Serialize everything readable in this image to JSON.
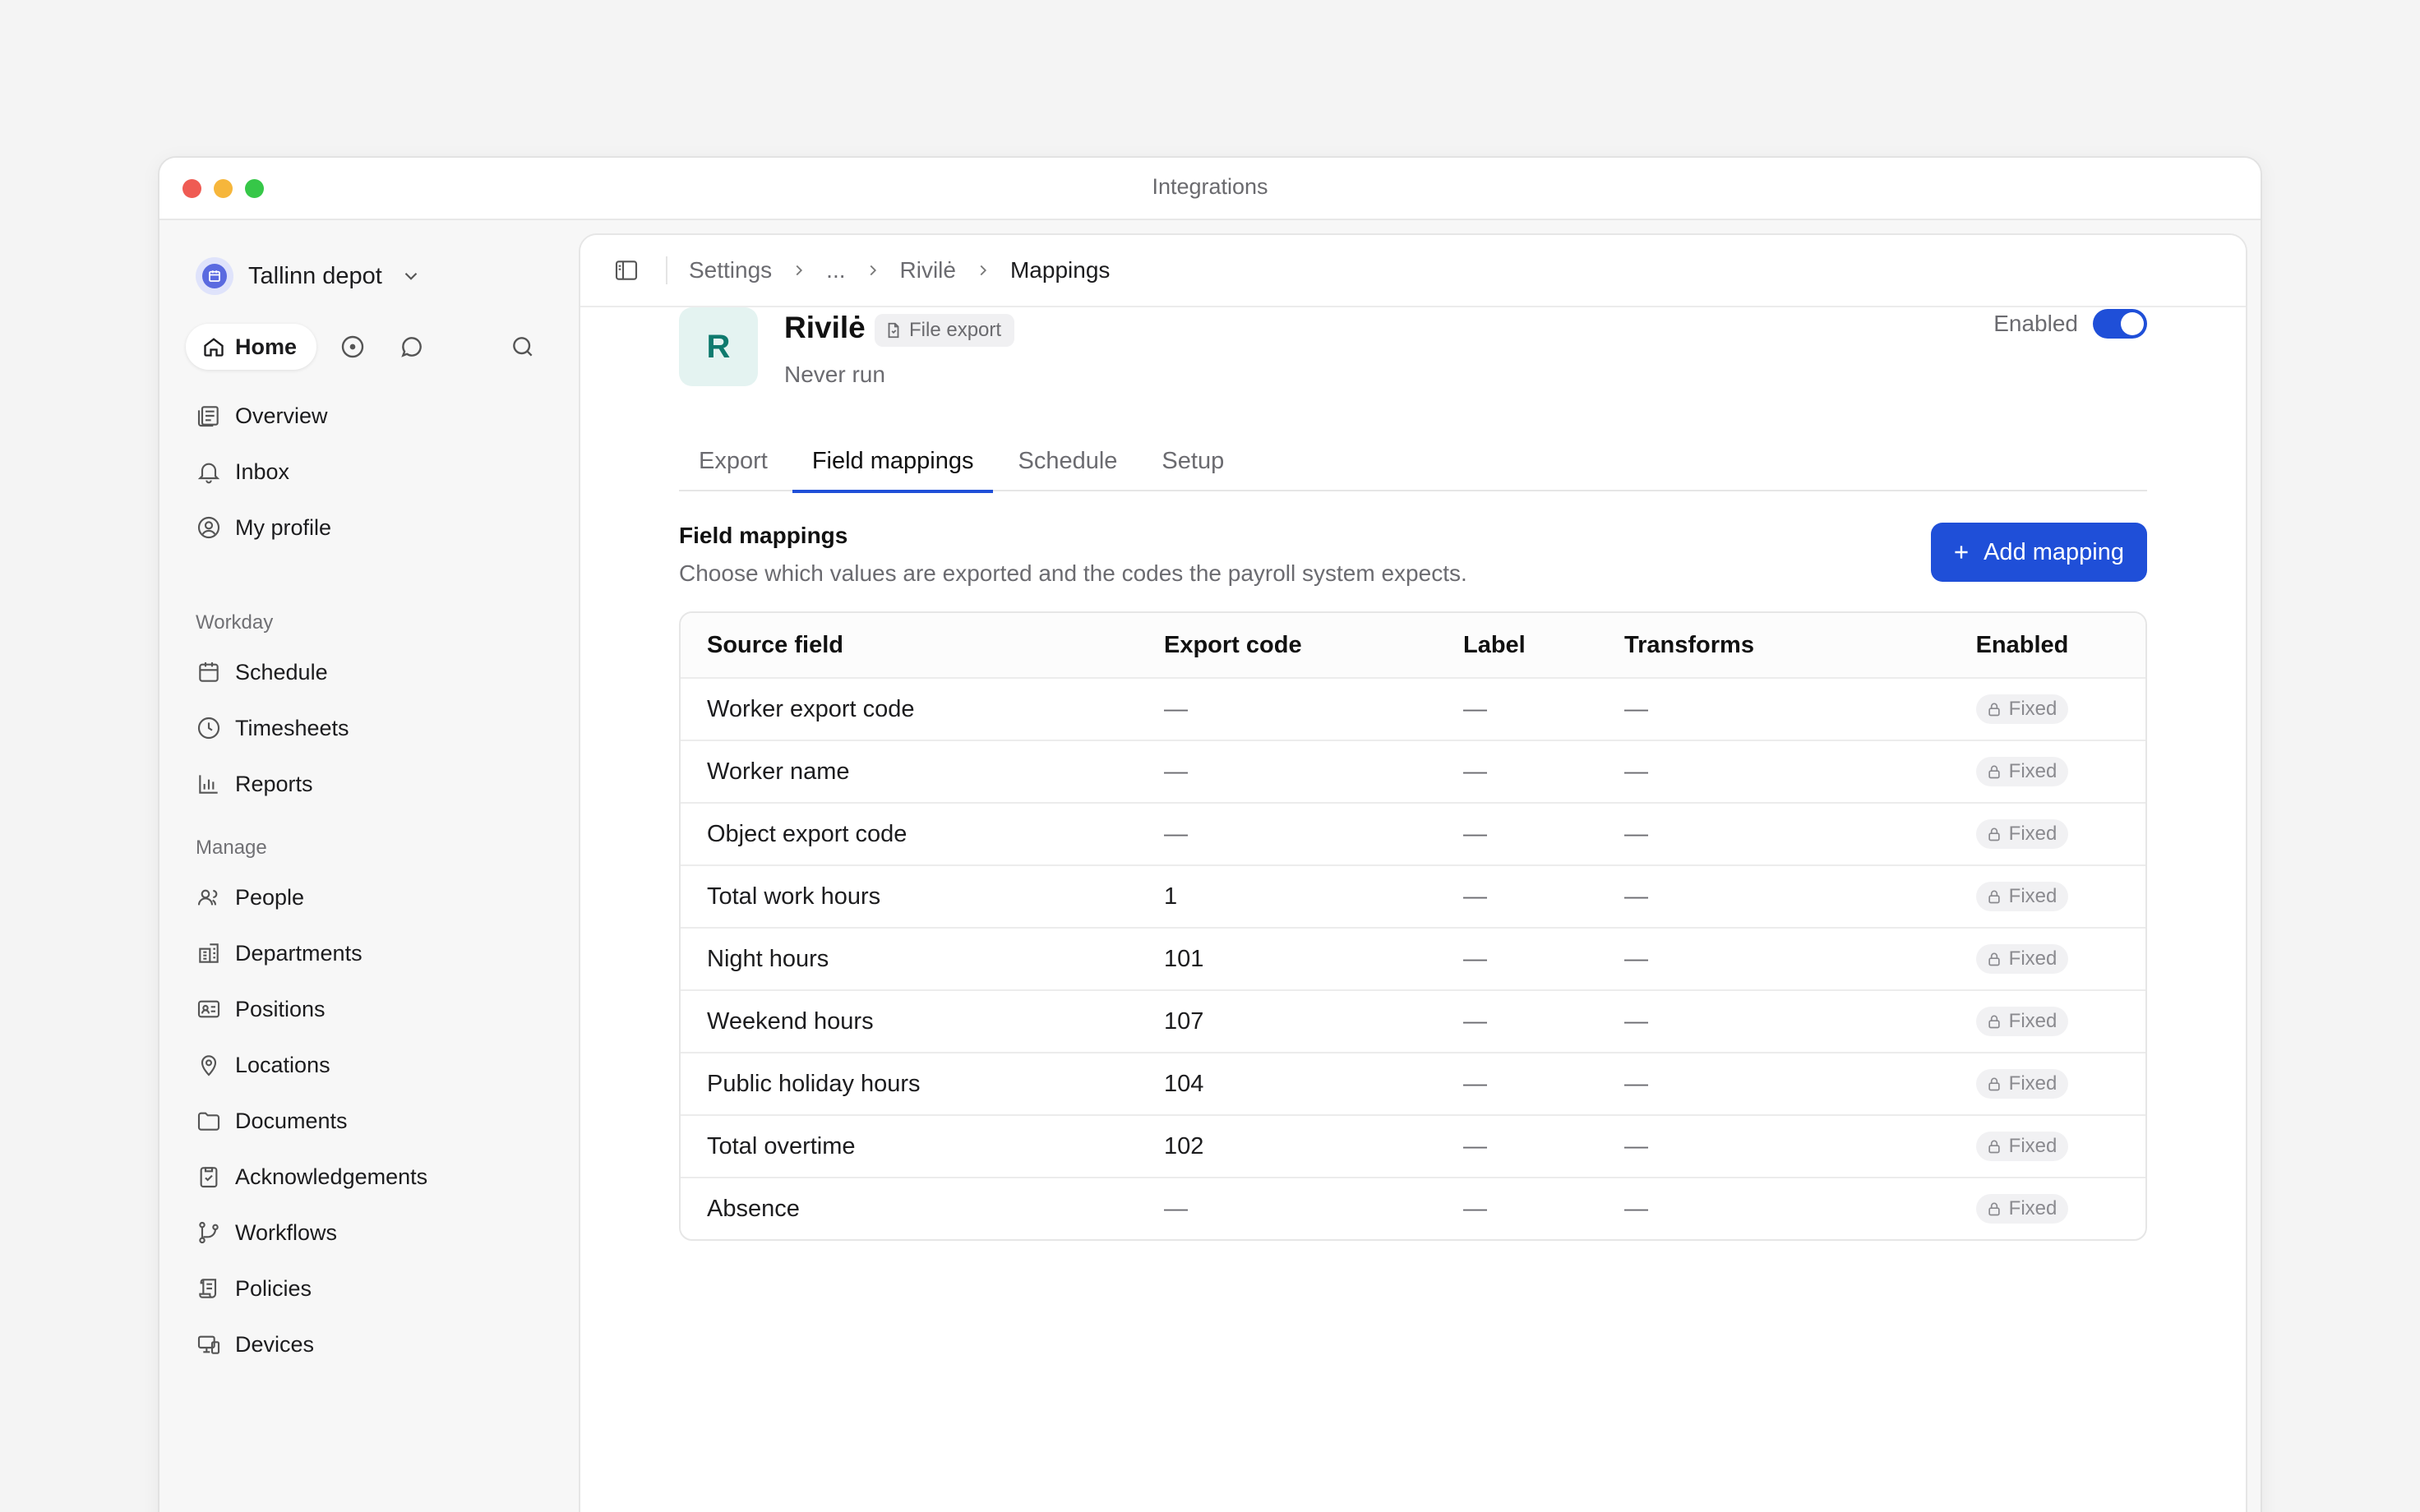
{
  "window": {
    "title": "Integrations"
  },
  "sidebar": {
    "workspace": {
      "name": "Tallinn depot"
    },
    "home_label": "Home",
    "top_items": [
      {
        "label": "Overview",
        "icon": "overview-icon"
      },
      {
        "label": "Inbox",
        "icon": "bell-icon"
      },
      {
        "label": "My profile",
        "icon": "profile-icon"
      }
    ],
    "workday": {
      "title": "Workday",
      "items": [
        {
          "label": "Schedule",
          "icon": "calendar-icon"
        },
        {
          "label": "Timesheets",
          "icon": "clock-icon"
        },
        {
          "label": "Reports",
          "icon": "bar-chart-icon"
        }
      ]
    },
    "manage": {
      "title": "Manage",
      "items": [
        {
          "label": "People",
          "icon": "people-icon"
        },
        {
          "label": "Departments",
          "icon": "building-icon"
        },
        {
          "label": "Positions",
          "icon": "id-card-icon"
        },
        {
          "label": "Locations",
          "icon": "map-pin-icon"
        },
        {
          "label": "Documents",
          "icon": "folder-icon"
        },
        {
          "label": "Acknowledgements",
          "icon": "clipboard-check-icon"
        },
        {
          "label": "Workflows",
          "icon": "git-branch-icon"
        },
        {
          "label": "Policies",
          "icon": "scroll-icon"
        },
        {
          "label": "Devices",
          "icon": "devices-icon"
        }
      ]
    }
  },
  "breadcrumb": [
    "Settings",
    "...",
    "Rivilė",
    "Mappings"
  ],
  "integration": {
    "logo_letter": "R",
    "name": "Rivilė",
    "badge": "File export",
    "status": "Never run",
    "enabled_label": "Enabled",
    "enabled": true
  },
  "tabs": [
    {
      "label": "Export",
      "active": false
    },
    {
      "label": "Field mappings",
      "active": true
    },
    {
      "label": "Schedule",
      "active": false
    },
    {
      "label": "Setup",
      "active": false
    }
  ],
  "section": {
    "title": "Field mappings",
    "description": "Choose which values are exported and the codes the payroll system expects.",
    "add_button": "Add mapping"
  },
  "table": {
    "columns": [
      "Source field",
      "Export code",
      "Label",
      "Transforms",
      "Enabled"
    ],
    "rows": [
      {
        "source": "Worker export code",
        "code": "—",
        "label": "—",
        "transforms": "—",
        "enabled": "Fixed"
      },
      {
        "source": "Worker name",
        "code": "—",
        "label": "—",
        "transforms": "—",
        "enabled": "Fixed"
      },
      {
        "source": "Object export code",
        "code": "—",
        "label": "—",
        "transforms": "—",
        "enabled": "Fixed"
      },
      {
        "source": "Total work hours",
        "code": "1",
        "label": "—",
        "transforms": "—",
        "enabled": "Fixed"
      },
      {
        "source": "Night hours",
        "code": "101",
        "label": "—",
        "transforms": "—",
        "enabled": "Fixed"
      },
      {
        "source": "Weekend hours",
        "code": "107",
        "label": "—",
        "transforms": "—",
        "enabled": "Fixed"
      },
      {
        "source": "Public holiday hours",
        "code": "104",
        "label": "—",
        "transforms": "—",
        "enabled": "Fixed"
      },
      {
        "source": "Total overtime",
        "code": "102",
        "label": "—",
        "transforms": "—",
        "enabled": "Fixed"
      },
      {
        "source": "Absence",
        "code": "—",
        "label": "—",
        "transforms": "—",
        "enabled": "Fixed"
      }
    ]
  },
  "colors": {
    "accent": "#1f4fd8",
    "logo_bg": "#e4f3f1",
    "logo_fg": "#0e7a6e"
  }
}
